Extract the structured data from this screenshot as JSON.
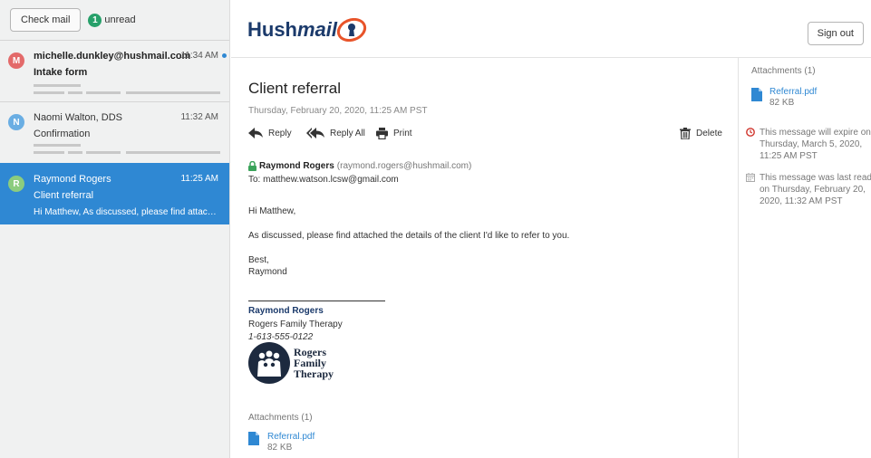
{
  "sidebar": {
    "check_mail_label": "Check mail",
    "unread_count": "1",
    "unread_label": "unread",
    "messages": [
      {
        "initial": "M",
        "avatar_color": "#e36a6a",
        "sender": "michelle.dunkley@hushmail.com",
        "time": "11:34 AM",
        "subject": "Intake form",
        "preview": "",
        "unread": true,
        "selected": false
      },
      {
        "initial": "N",
        "avatar_color": "#6aaee3",
        "sender": "Naomi Walton, DDS",
        "time": "11:32 AM",
        "subject": "Confirmation",
        "preview": "",
        "unread": false,
        "selected": false
      },
      {
        "initial": "R",
        "avatar_color": "#8ccc7e",
        "sender": "Raymond Rogers",
        "time": "11:25 AM",
        "subject": "Client referral",
        "preview": "Hi Matthew, As discussed, please find attached the det...",
        "unread": false,
        "selected": true
      }
    ]
  },
  "header": {
    "logo_text_a": "Hush",
    "logo_text_b": "mail",
    "sign_out_label": "Sign out"
  },
  "message": {
    "title": "Client referral",
    "date": "Thursday, February 20, 2020, 11:25 AM PST",
    "actions": {
      "reply": "Reply",
      "reply_all": "Reply All",
      "print": "Print",
      "delete": "Delete"
    },
    "from_name": "Raymond Rogers",
    "from_email": "(raymond.rogers@hushmail.com)",
    "to": "To: matthew.watson.lcsw@gmail.com",
    "body": {
      "greeting": "Hi Matthew,",
      "paragraph": "As discussed, please find attached the details of the client I'd like to refer to you.",
      "closing": "Best,",
      "closing_name": "Raymond"
    },
    "signature": {
      "name": "Raymond Rogers",
      "company": "Rogers Family Therapy",
      "phone": "1-613-555-0122",
      "logo_line1": "Rogers",
      "logo_line2": "Family",
      "logo_line3": "Therapy"
    },
    "attachments_label": "Attachments (1)",
    "attachment": {
      "name": "Referral.pdf",
      "size": "82 KB"
    }
  },
  "right_panel": {
    "attachments_label": "Attachments (1)",
    "attachment": {
      "name": "Referral.pdf",
      "size": "82 KB"
    },
    "expire_text": "This message will expire on Thursday, March 5, 2020, 11:25 AM PST",
    "last_read_text": "This message was last read on Thursday, February 20, 2020, 11:32 AM PST"
  },
  "colors": {
    "accent": "#2f88d3",
    "brand": "#1b3a6b",
    "logo_orange": "#e8542a",
    "unread_badge": "#27a06a",
    "expire_red": "#d0342c"
  }
}
